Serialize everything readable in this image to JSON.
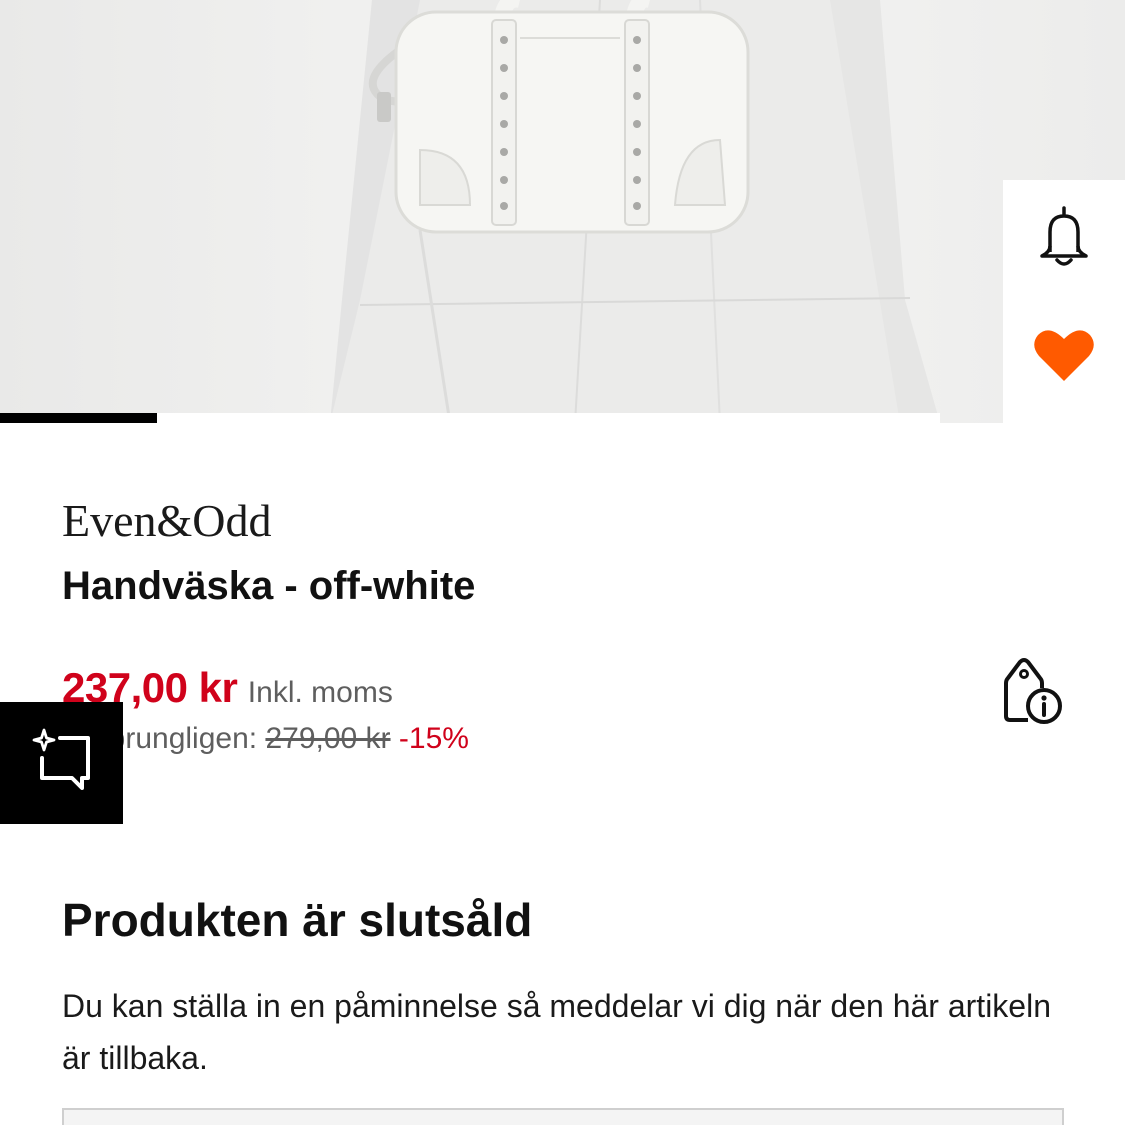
{
  "brand": "Even&Odd",
  "product_name": "Handväska - off-white",
  "price": {
    "current": "237,00 kr",
    "vat_note": "Inkl. moms",
    "original_label": "Ursprungligen:",
    "original_price": "279,00 kr",
    "discount": "-15%"
  },
  "soldout": {
    "title": "Produkten är slutsåld",
    "text": "Du kan ställa in en påminnelse så meddelar vi dig när den här artikeln är tillbaka."
  },
  "image_carousel": {
    "progress": 0.167
  },
  "icons": {
    "bell": "bell-icon",
    "heart": "heart-icon",
    "price_info": "price-tag-info-icon",
    "ai": "sparkle-chat-icon"
  },
  "colors": {
    "price_red": "#d0021b",
    "heart_orange": "#ff5a00",
    "text_dark": "#1a1a1a",
    "text_muted": "#5e5e5e"
  }
}
